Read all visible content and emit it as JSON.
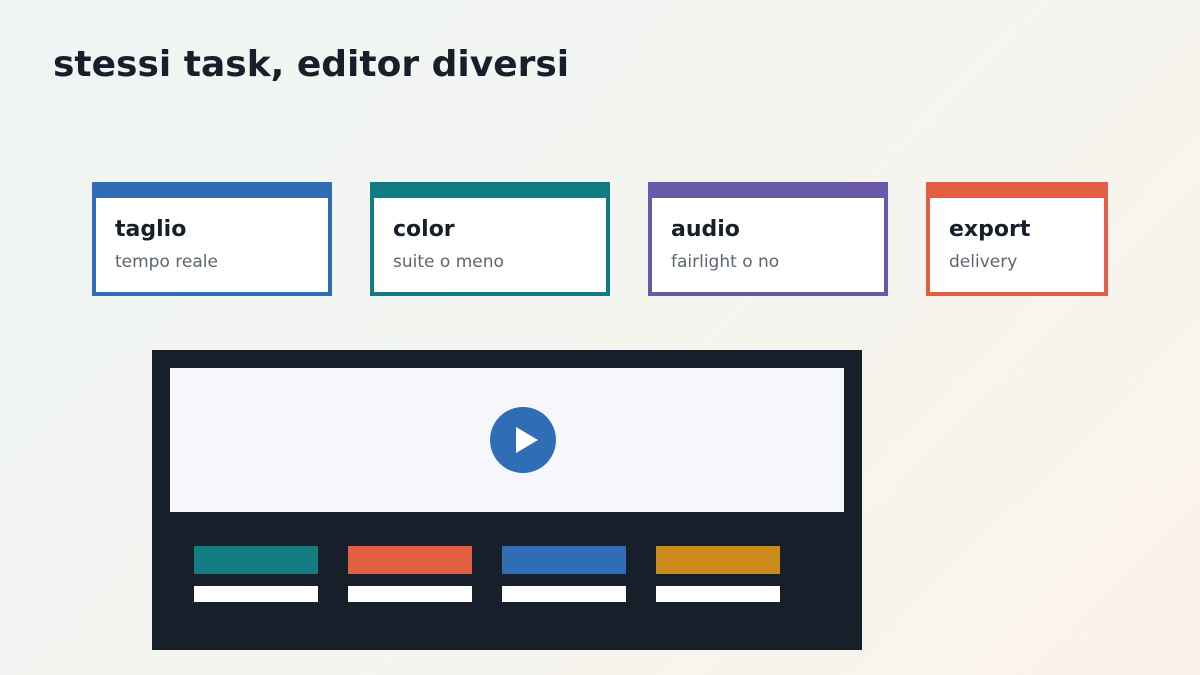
{
  "title": "stessi task, editor diversi",
  "cards": [
    {
      "title": "taglio",
      "subtitle": "tempo reale",
      "color": "#2f6db5"
    },
    {
      "title": "color",
      "subtitle": "suite o meno",
      "color": "#127c80"
    },
    {
      "title": "audio",
      "subtitle": "fairlight o no",
      "color": "#6a58a8"
    },
    {
      "title": "export",
      "subtitle": "delivery",
      "color": "#e35f43"
    }
  ],
  "editor": {
    "background": "#17202a",
    "preview_background": "#f5f7fa",
    "play_icon": "play-icon",
    "play_color": "#2f6db5",
    "tracks": [
      {
        "color": "#127c80"
      },
      {
        "color": "#e35f43"
      },
      {
        "color": "#2f6db5"
      },
      {
        "color": "#cc8a1a"
      }
    ]
  }
}
